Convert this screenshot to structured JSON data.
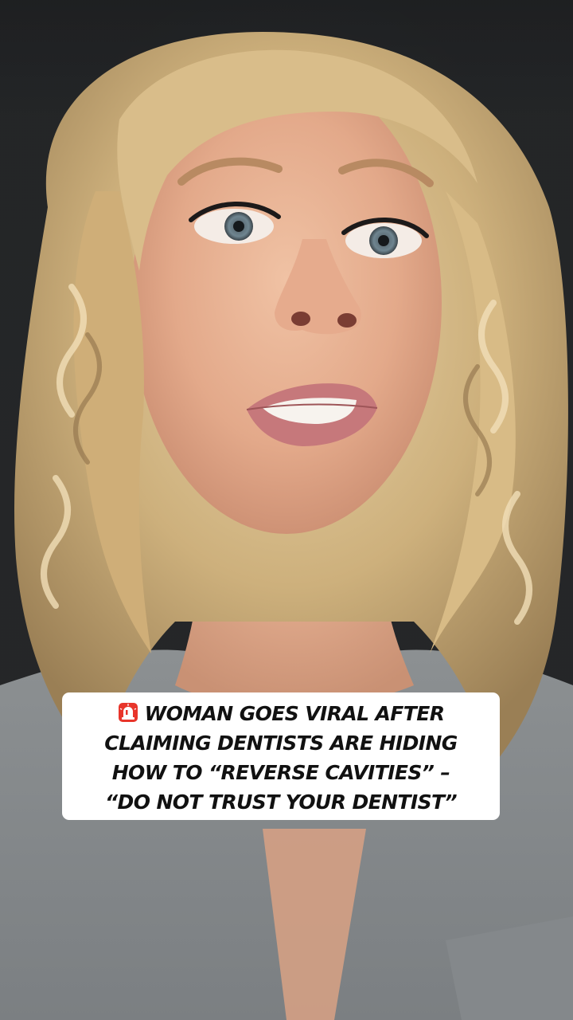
{
  "post": {
    "headline_lines": [
      "WOMAN GOES VIRAL AFTER",
      "CLAIMING DENTISTS ARE HIDING",
      "HOW TO “REVERSE CAVITIES” –",
      "“DO NOT TRUST YOUR DENTIST”"
    ],
    "headline_icon": "siren-icon"
  },
  "colors": {
    "caption_background": "#ffffff",
    "caption_text": "#111111",
    "siren_red": "#e8352b"
  }
}
